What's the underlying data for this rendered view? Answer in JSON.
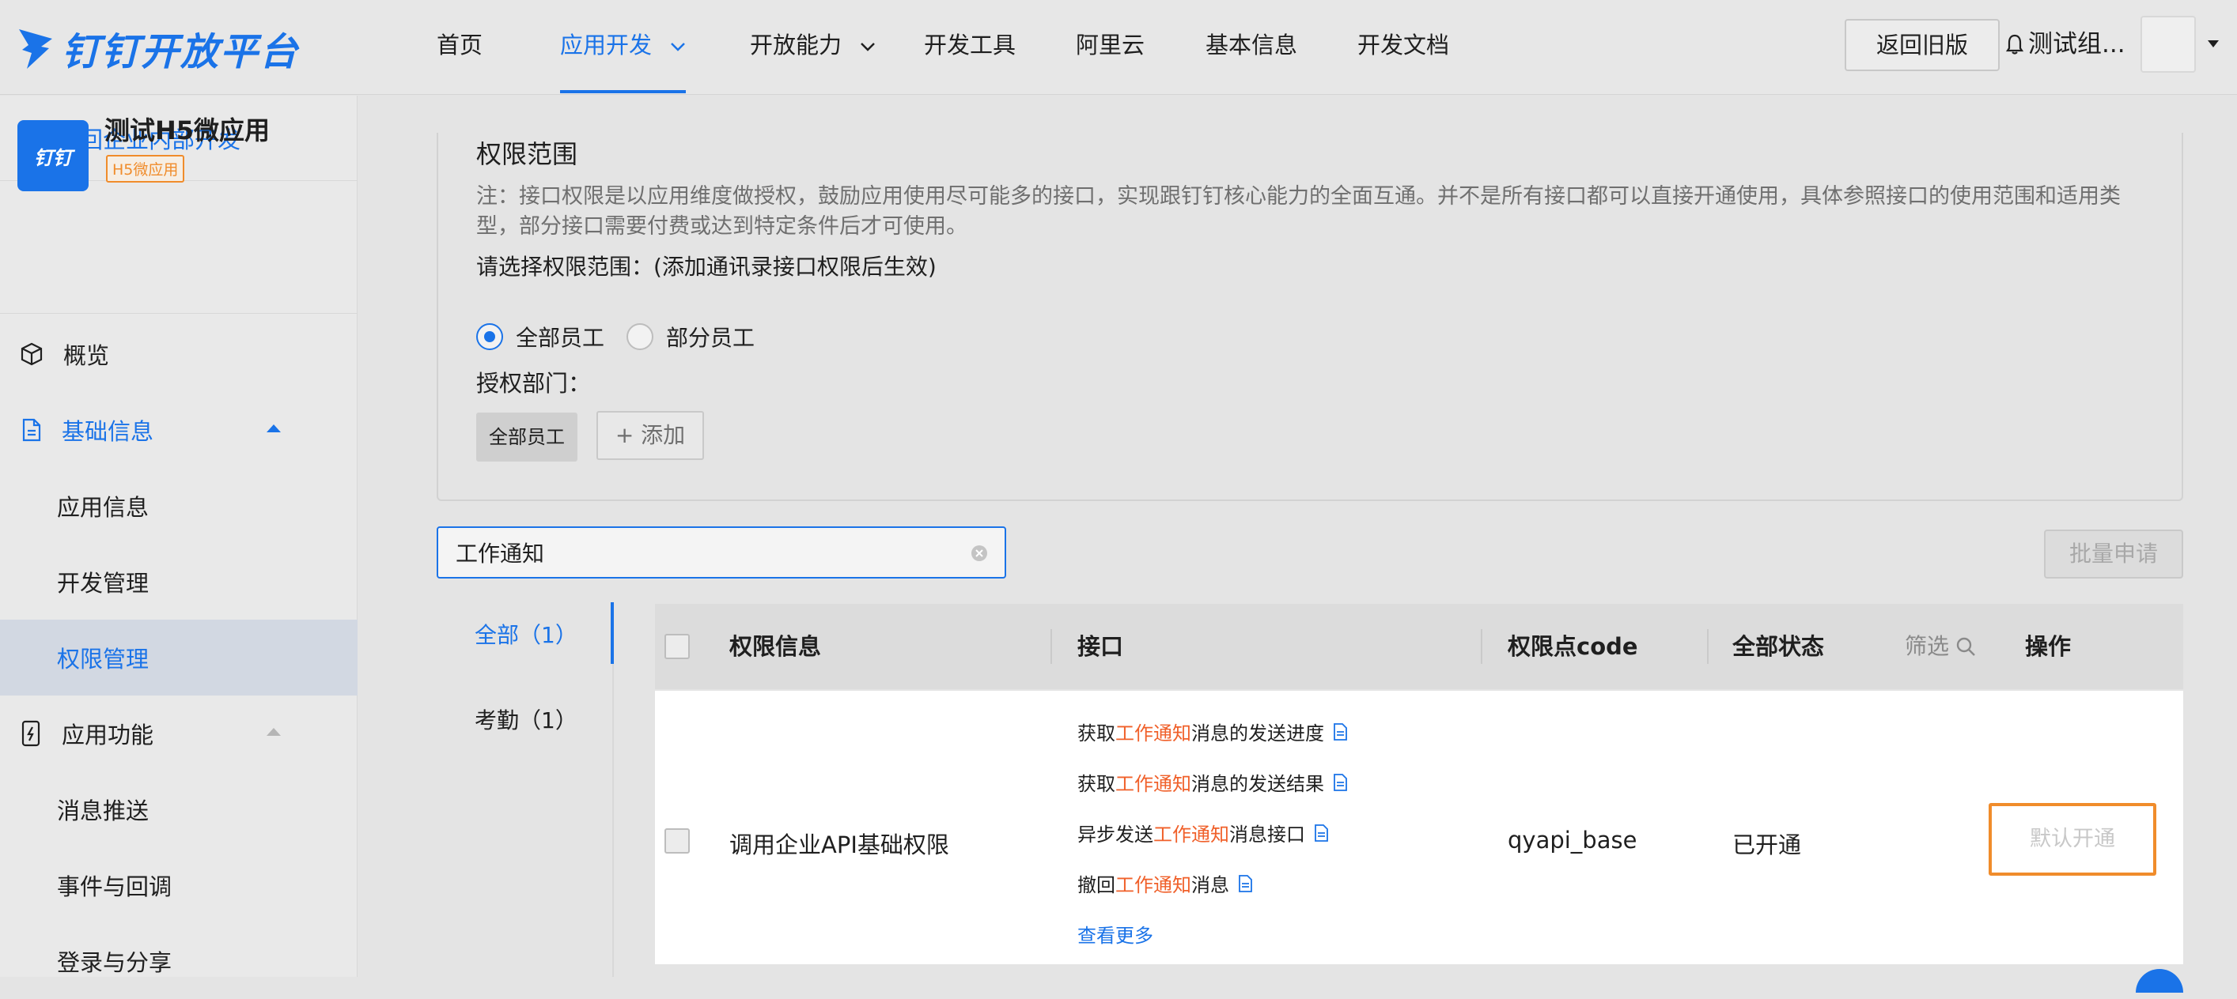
{
  "header": {
    "logo_text": "钉钉开放平台",
    "nav": [
      {
        "label": "首页"
      },
      {
        "label": "应用开发"
      },
      {
        "label": "开放能力"
      },
      {
        "label": "开发工具"
      },
      {
        "label": "阿里云"
      },
      {
        "label": "基本信息"
      },
      {
        "label": "开发文档"
      }
    ],
    "back_old_label": "返回旧版",
    "org_name": "测试组..."
  },
  "sidebar": {
    "back_label": "返回企业内部开发",
    "app": {
      "name": "测试H5微应用",
      "badge": "H5微应用",
      "logo_text": "钉钉"
    },
    "items": [
      {
        "label": "概览"
      },
      {
        "label": "基础信息"
      },
      {
        "label": "应用信息"
      },
      {
        "label": "开发管理"
      },
      {
        "label": "权限管理"
      },
      {
        "label": "应用功能"
      },
      {
        "label": "消息推送"
      },
      {
        "label": "事件与回调"
      },
      {
        "label": "登录与分享"
      }
    ]
  },
  "scope": {
    "title": "权限范围",
    "note": "注：接口权限是以应用维度做授权，鼓励应用使用尽可能多的接口，实现跟钉钉核心能力的全面互通。并不是所有接口都可以直接开通使用，具体参照接口的使用范围和适用类型，部分接口需要付费或达到特定条件后才可使用。",
    "select_label": "请选择权限范围：(添加通讯录接口权限后生效)",
    "radio_all": "全部员工",
    "radio_part": "部分员工",
    "selected": "全部员工",
    "auth_dept_label": "授权部门：",
    "dept_tag": "全部员工",
    "add_label": "+ 添加"
  },
  "search": {
    "value": "工作通知"
  },
  "batch_label": "批量申请",
  "categories": [
    {
      "label": "全部（1）"
    },
    {
      "label": "考勤（1）"
    }
  ],
  "table": {
    "headers": {
      "info": "权限信息",
      "api": "接口",
      "code": "权限点code",
      "status": "全部状态",
      "filter": "筛选",
      "action": "操作"
    },
    "rows": [
      {
        "name": "调用企业API基础权限",
        "apis": [
          {
            "pre": "获取",
            "hl": "工作通知",
            "post": "消息的发送进度"
          },
          {
            "pre": "获取",
            "hl": "工作通知",
            "post": "消息的发送结果"
          },
          {
            "pre": "异步发送",
            "hl": "工作通知",
            "post": "消息接口"
          },
          {
            "pre": "撤回",
            "hl": "工作通知",
            "post": "消息"
          }
        ],
        "more_label": "查看更多",
        "code": "qyapi_base",
        "status": "已开通",
        "action_label": "默认开通"
      }
    ]
  },
  "colors": {
    "accent": "#1a73e8",
    "highlight": "#f0602a",
    "badge_orange": "#f08c2b"
  }
}
